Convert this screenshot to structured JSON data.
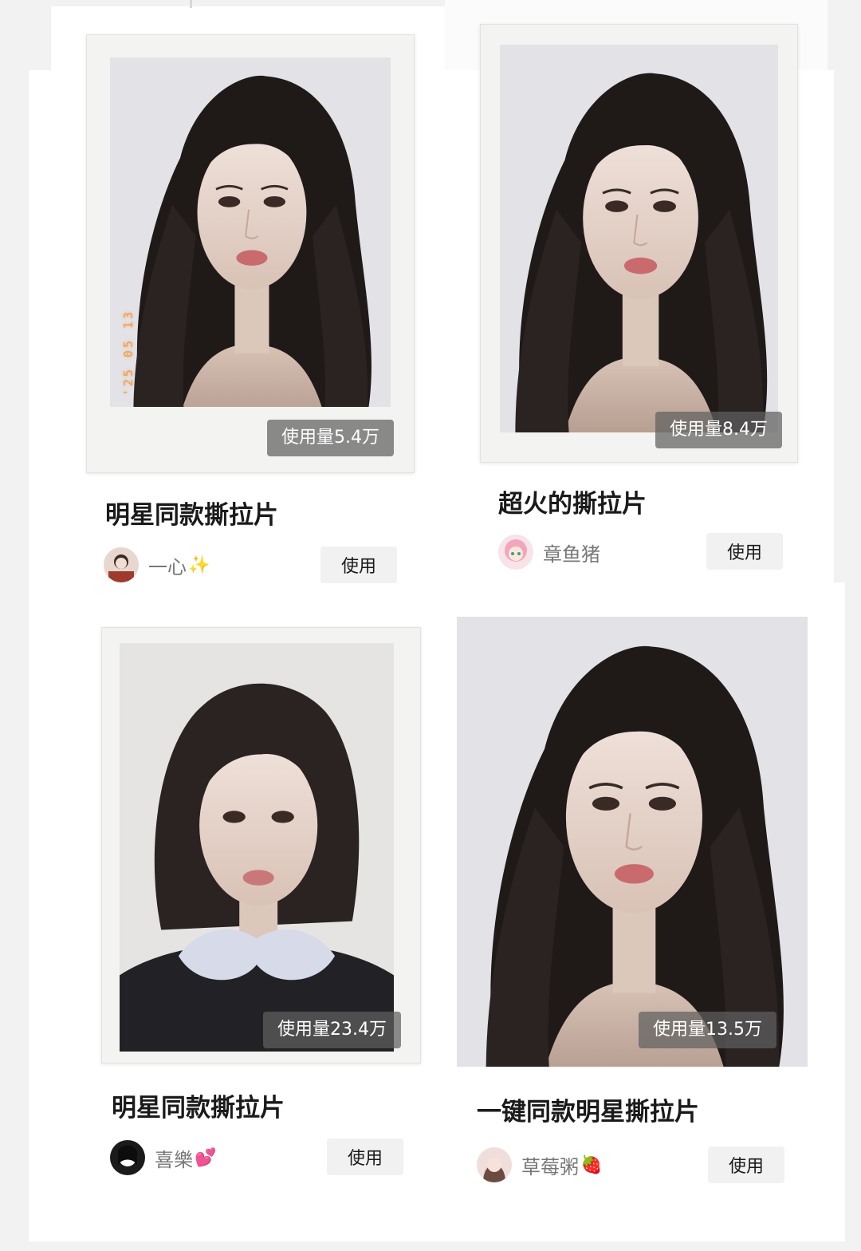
{
  "cards": [
    {
      "usage": "使用量5.4万",
      "title": "明星同款撕拉片",
      "author": "一心",
      "author_emoji": "✨",
      "use_label": "使用",
      "date_stamp": "'25 05 13"
    },
    {
      "usage": "使用量8.4万",
      "title": "超火的撕拉片",
      "author": "章鱼猪",
      "author_emoji": "",
      "use_label": "使用"
    },
    {
      "usage": "使用量23.4万",
      "title": "明星同款撕拉片",
      "author": "喜樂",
      "author_emoji": "💕",
      "use_label": "使用"
    },
    {
      "usage": "使用量13.5万",
      "title": "一键同款明星撕拉片",
      "author": "草莓粥",
      "author_emoji": "🍓",
      "use_label": "使用"
    }
  ],
  "icons": {
    "photo": "portrait-photo-icon",
    "avatar": "user-avatar-icon"
  },
  "colors": {
    "usage_badge_bg": "#5f5f5f",
    "date_stamp": "#e9a04e",
    "use_button_bg": "#f1f1f1"
  }
}
